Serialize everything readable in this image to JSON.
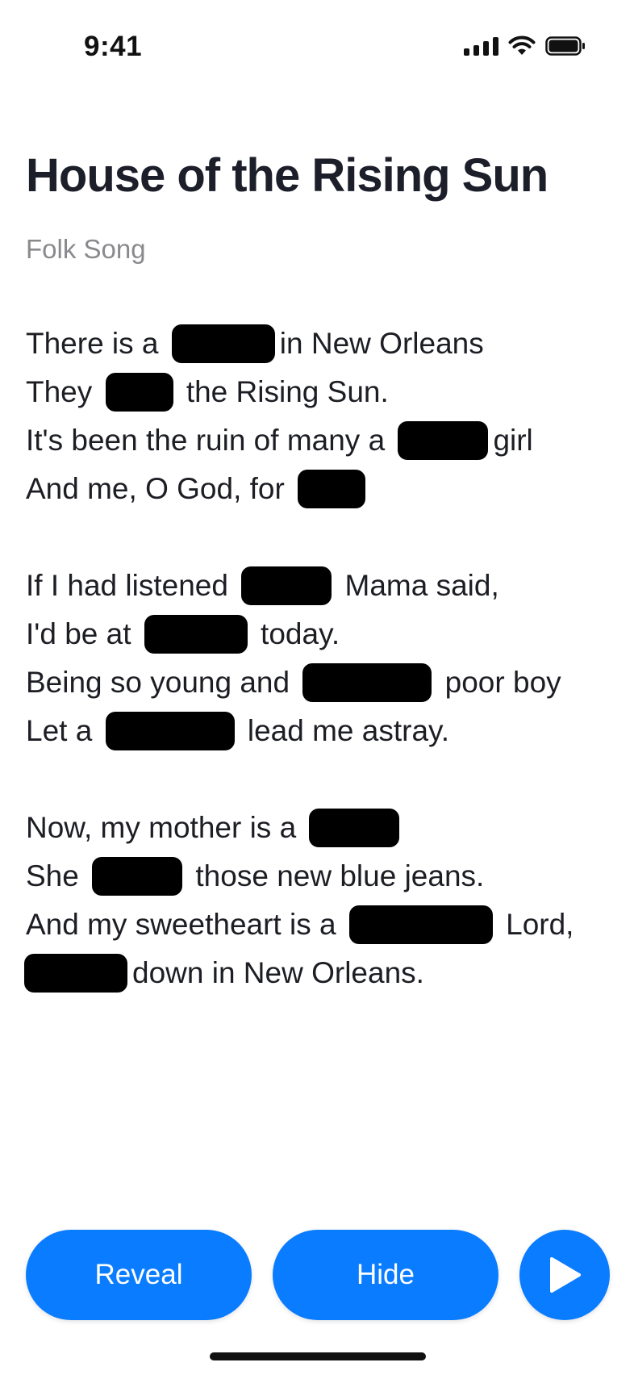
{
  "status_bar": {
    "time": "9:41"
  },
  "song": {
    "title": "House of the Rising Sun",
    "subtitle": "Folk Song"
  },
  "stanzas": [
    [
      [
        "There is a ",
        "",
        "in New Orleans"
      ],
      [
        "They ",
        "",
        " the Rising Sun."
      ],
      [
        "It's been the ruin of many a ",
        "",
        "girl"
      ],
      [
        "And me, O God, for ",
        "",
        ""
      ]
    ],
    [
      [
        "If I had listened ",
        "",
        " Mama said,"
      ],
      [
        "I'd be at ",
        "",
        " today."
      ],
      [
        "Being so young and ",
        "",
        " poor boy"
      ],
      [
        "Let a ",
        "",
        " lead me astray."
      ]
    ],
    [
      [
        "Now, my mother is a ",
        "",
        ""
      ],
      [
        "She ",
        "",
        " those new blue jeans."
      ],
      [
        "And my sweetheart is a ",
        "",
        " Lord,"
      ],
      [
        "",
        "",
        "down in New Orleans."
      ]
    ]
  ],
  "buttons": {
    "reveal": "Reveal",
    "hide": "Hide"
  },
  "colors": {
    "accent": "#0a7cff",
    "blank": "#000000",
    "title": "#1c1f2a",
    "subtitle": "#8a8a8e"
  },
  "icons": {
    "play": "play-icon",
    "signal": "cellular-signal-icon",
    "wifi": "wifi-icon",
    "battery": "battery-icon"
  }
}
